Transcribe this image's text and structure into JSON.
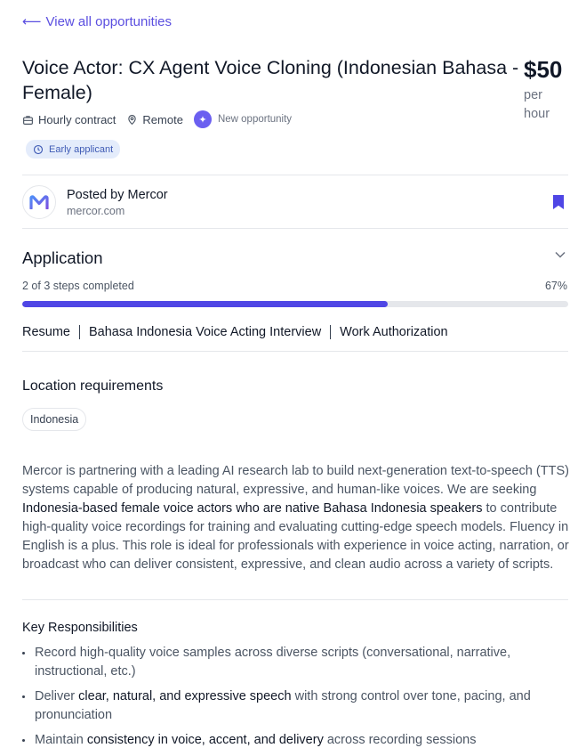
{
  "nav": {
    "back_label": "View all opportunities"
  },
  "job": {
    "title": "Voice Actor: CX Agent Voice Cloning (Indonesian Bahasa - Female)",
    "price": "$50",
    "price_unit_line1": "per",
    "price_unit_line2": "hour",
    "meta": {
      "contract": "Hourly contract",
      "location": "Remote",
      "new_label": "New opportunity"
    },
    "early_badge": "Early applicant"
  },
  "poster": {
    "name": "Posted by Mercor",
    "url": "mercor.com"
  },
  "application": {
    "heading": "Application",
    "steps_text": "2 of 3 steps completed",
    "percent_label": "67%",
    "progress_fraction": 0.67,
    "steps": [
      "Resume",
      "Bahasa Indonesia Voice Acting Interview",
      "Work Authorization"
    ]
  },
  "location": {
    "heading": "Location requirements",
    "chip": "Indonesia"
  },
  "description": {
    "part1": "Mercor is partnering with a leading AI research lab to build next-generation text-to-speech (TTS) systems capable of producing natural, expressive, and human-like voices. We are seeking ",
    "highlight": "Indonesia-based female voice actors who are native Bahasa Indonesia speakers",
    "part2": " to contribute high-quality voice recordings for training and evaluating cutting-edge speech models. Fluency in English is a plus. This role is ideal for professionals with experience in voice acting, narration, or broadcast who can deliver consistent, expressive, and clean audio across a variety of scripts."
  },
  "responsibilities": {
    "heading": "Key Responsibilities",
    "items": [
      {
        "pre": "Record high-quality voice samples across diverse scripts (conversational, narrative, instructional, etc.)",
        "hl": "",
        "post": ""
      },
      {
        "pre": "Deliver ",
        "hl": "clear, natural, and expressive speech",
        "post": " with strong control over tone, pacing, and pronunciation"
      },
      {
        "pre": "Maintain ",
        "hl": "consistency in voice, accent, and delivery",
        "post": " across recording sessions"
      }
    ]
  },
  "colors": {
    "accent": "#5b4fe0",
    "progress": "#4f46e5",
    "bookmark": "#4f46e5",
    "early_bg": "#e4ecfb"
  },
  "icons": [
    "briefcase-icon",
    "location-pin-icon",
    "sparkle-icon",
    "clock-icon",
    "mercor-logo",
    "bookmark-icon",
    "chevron-down-icon"
  ]
}
